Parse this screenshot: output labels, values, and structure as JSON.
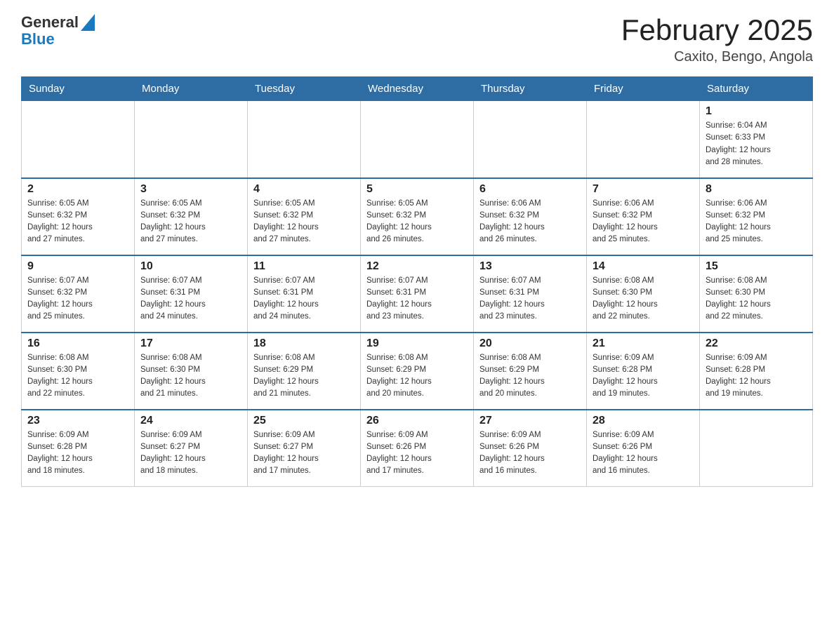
{
  "header": {
    "logo_general": "General",
    "logo_blue": "Blue",
    "title": "February 2025",
    "subtitle": "Caxito, Bengo, Angola"
  },
  "weekdays": [
    "Sunday",
    "Monday",
    "Tuesday",
    "Wednesday",
    "Thursday",
    "Friday",
    "Saturday"
  ],
  "weeks": [
    [
      {
        "day": "",
        "info": ""
      },
      {
        "day": "",
        "info": ""
      },
      {
        "day": "",
        "info": ""
      },
      {
        "day": "",
        "info": ""
      },
      {
        "day": "",
        "info": ""
      },
      {
        "day": "",
        "info": ""
      },
      {
        "day": "1",
        "info": "Sunrise: 6:04 AM\nSunset: 6:33 PM\nDaylight: 12 hours\nand 28 minutes."
      }
    ],
    [
      {
        "day": "2",
        "info": "Sunrise: 6:05 AM\nSunset: 6:32 PM\nDaylight: 12 hours\nand 27 minutes."
      },
      {
        "day": "3",
        "info": "Sunrise: 6:05 AM\nSunset: 6:32 PM\nDaylight: 12 hours\nand 27 minutes."
      },
      {
        "day": "4",
        "info": "Sunrise: 6:05 AM\nSunset: 6:32 PM\nDaylight: 12 hours\nand 27 minutes."
      },
      {
        "day": "5",
        "info": "Sunrise: 6:05 AM\nSunset: 6:32 PM\nDaylight: 12 hours\nand 26 minutes."
      },
      {
        "day": "6",
        "info": "Sunrise: 6:06 AM\nSunset: 6:32 PM\nDaylight: 12 hours\nand 26 minutes."
      },
      {
        "day": "7",
        "info": "Sunrise: 6:06 AM\nSunset: 6:32 PM\nDaylight: 12 hours\nand 25 minutes."
      },
      {
        "day": "8",
        "info": "Sunrise: 6:06 AM\nSunset: 6:32 PM\nDaylight: 12 hours\nand 25 minutes."
      }
    ],
    [
      {
        "day": "9",
        "info": "Sunrise: 6:07 AM\nSunset: 6:32 PM\nDaylight: 12 hours\nand 25 minutes."
      },
      {
        "day": "10",
        "info": "Sunrise: 6:07 AM\nSunset: 6:31 PM\nDaylight: 12 hours\nand 24 minutes."
      },
      {
        "day": "11",
        "info": "Sunrise: 6:07 AM\nSunset: 6:31 PM\nDaylight: 12 hours\nand 24 minutes."
      },
      {
        "day": "12",
        "info": "Sunrise: 6:07 AM\nSunset: 6:31 PM\nDaylight: 12 hours\nand 23 minutes."
      },
      {
        "day": "13",
        "info": "Sunrise: 6:07 AM\nSunset: 6:31 PM\nDaylight: 12 hours\nand 23 minutes."
      },
      {
        "day": "14",
        "info": "Sunrise: 6:08 AM\nSunset: 6:30 PM\nDaylight: 12 hours\nand 22 minutes."
      },
      {
        "day": "15",
        "info": "Sunrise: 6:08 AM\nSunset: 6:30 PM\nDaylight: 12 hours\nand 22 minutes."
      }
    ],
    [
      {
        "day": "16",
        "info": "Sunrise: 6:08 AM\nSunset: 6:30 PM\nDaylight: 12 hours\nand 22 minutes."
      },
      {
        "day": "17",
        "info": "Sunrise: 6:08 AM\nSunset: 6:30 PM\nDaylight: 12 hours\nand 21 minutes."
      },
      {
        "day": "18",
        "info": "Sunrise: 6:08 AM\nSunset: 6:29 PM\nDaylight: 12 hours\nand 21 minutes."
      },
      {
        "day": "19",
        "info": "Sunrise: 6:08 AM\nSunset: 6:29 PM\nDaylight: 12 hours\nand 20 minutes."
      },
      {
        "day": "20",
        "info": "Sunrise: 6:08 AM\nSunset: 6:29 PM\nDaylight: 12 hours\nand 20 minutes."
      },
      {
        "day": "21",
        "info": "Sunrise: 6:09 AM\nSunset: 6:28 PM\nDaylight: 12 hours\nand 19 minutes."
      },
      {
        "day": "22",
        "info": "Sunrise: 6:09 AM\nSunset: 6:28 PM\nDaylight: 12 hours\nand 19 minutes."
      }
    ],
    [
      {
        "day": "23",
        "info": "Sunrise: 6:09 AM\nSunset: 6:28 PM\nDaylight: 12 hours\nand 18 minutes."
      },
      {
        "day": "24",
        "info": "Sunrise: 6:09 AM\nSunset: 6:27 PM\nDaylight: 12 hours\nand 18 minutes."
      },
      {
        "day": "25",
        "info": "Sunrise: 6:09 AM\nSunset: 6:27 PM\nDaylight: 12 hours\nand 17 minutes."
      },
      {
        "day": "26",
        "info": "Sunrise: 6:09 AM\nSunset: 6:26 PM\nDaylight: 12 hours\nand 17 minutes."
      },
      {
        "day": "27",
        "info": "Sunrise: 6:09 AM\nSunset: 6:26 PM\nDaylight: 12 hours\nand 16 minutes."
      },
      {
        "day": "28",
        "info": "Sunrise: 6:09 AM\nSunset: 6:26 PM\nDaylight: 12 hours\nand 16 minutes."
      },
      {
        "day": "",
        "info": ""
      }
    ]
  ]
}
